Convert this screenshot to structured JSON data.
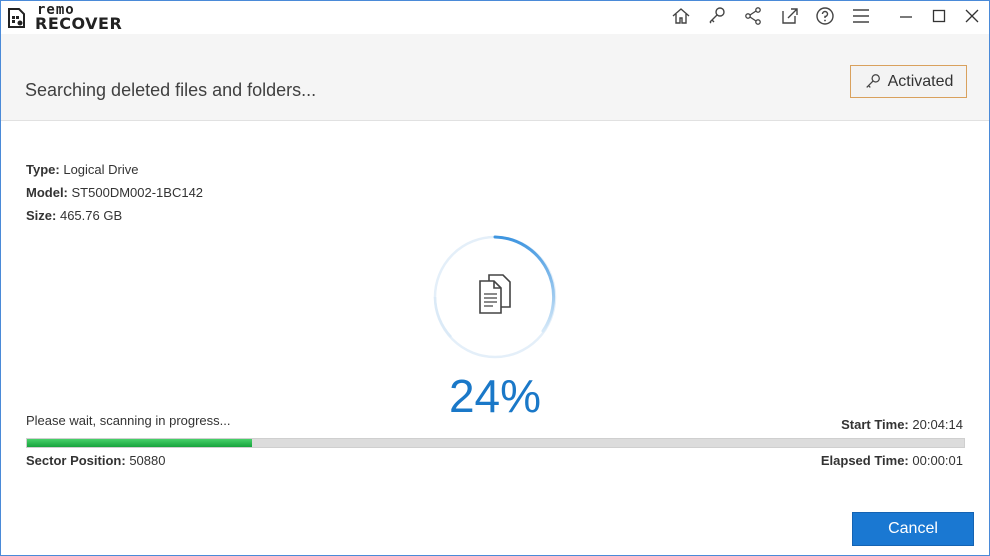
{
  "app": {
    "logo_top": "remo",
    "logo_bottom": "RECOVER"
  },
  "toolbar_icons": [
    "home-icon",
    "key-icon",
    "share-icon",
    "export-icon",
    "help-icon",
    "menu-icon"
  ],
  "window_controls": [
    "minimize-icon",
    "maximize-icon",
    "close-icon"
  ],
  "header": {
    "status_title": "Searching deleted files and folders...",
    "activated_label": "Activated"
  },
  "drive": {
    "type_label": "Type:",
    "type_value": "Logical Drive",
    "model_label": "Model:",
    "model_value": "ST500DM002-1BC142",
    "size_label": "Size:",
    "size_value": "465.76 GB"
  },
  "progress": {
    "percent_text": "24%",
    "percent_value": 24,
    "wait_text": "Please wait, scanning in progress...",
    "start_time_label": "Start Time:",
    "start_time_value": "20:04:14",
    "elapsed_time_label": "Elapsed Time:",
    "elapsed_time_value": "00:00:01",
    "sector_label": "Sector Position:",
    "sector_value": "50880"
  },
  "footer": {
    "cancel_label": "Cancel"
  },
  "colors": {
    "accent_blue": "#1a78c8",
    "progress_green": "#17a33d",
    "activated_border": "#d9a15d"
  }
}
